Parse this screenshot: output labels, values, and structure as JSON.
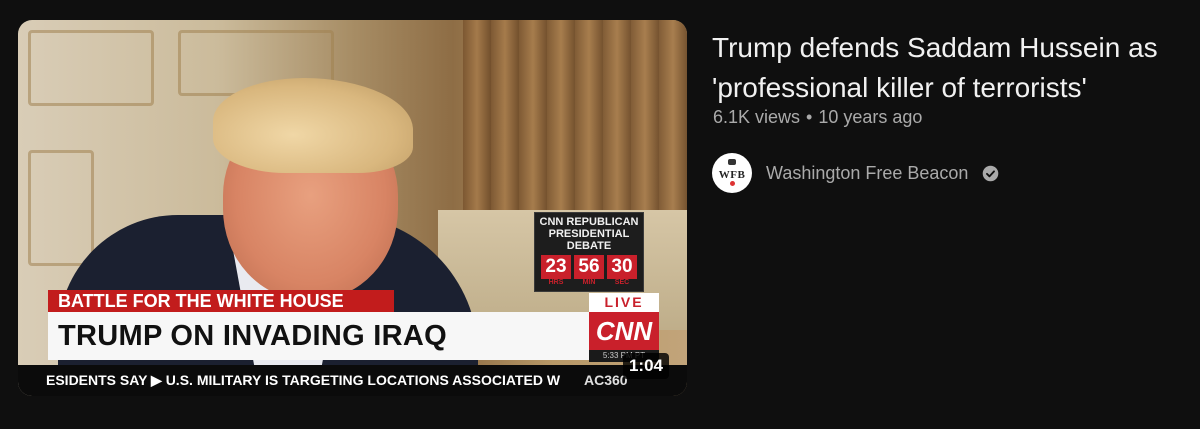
{
  "video": {
    "title": "Trump defends Saddam Hussein as 'professional killer of terrorists'",
    "views": "6.1K views",
    "separator": "•",
    "age": "10 years ago",
    "duration": "1:04"
  },
  "channel": {
    "name": "Washington Free Beacon",
    "avatar_text": "WFB",
    "verified_icon": "verified-check-icon"
  },
  "thumbnail": {
    "timer_title": "CNN REPUBLICAN PRESIDENTIAL DEBATE",
    "timer_hours": "23",
    "timer_minutes": "56",
    "timer_seconds": "30",
    "timer_unit_hrs": "HRS",
    "timer_unit_min": "MIN",
    "timer_unit_sec": "SEC",
    "banner_top": "BATTLE FOR THE WHITE HOUSE",
    "banner_main": "TRUMP ON INVADING IRAQ",
    "live_label": "LIVE",
    "network_logo": "CNN",
    "network_time": "5:33 PM PT",
    "ticker_text": "ESIDENTS SAY   ▶  U.S. MILITARY IS TARGETING LOCATIONS ASSOCIATED W",
    "ticker_show": "AC360"
  },
  "colors": {
    "background": "#0f0f0f",
    "title": "#f1f1f1",
    "meta": "#aaaaaa",
    "cnn_red": "#c9202b"
  }
}
